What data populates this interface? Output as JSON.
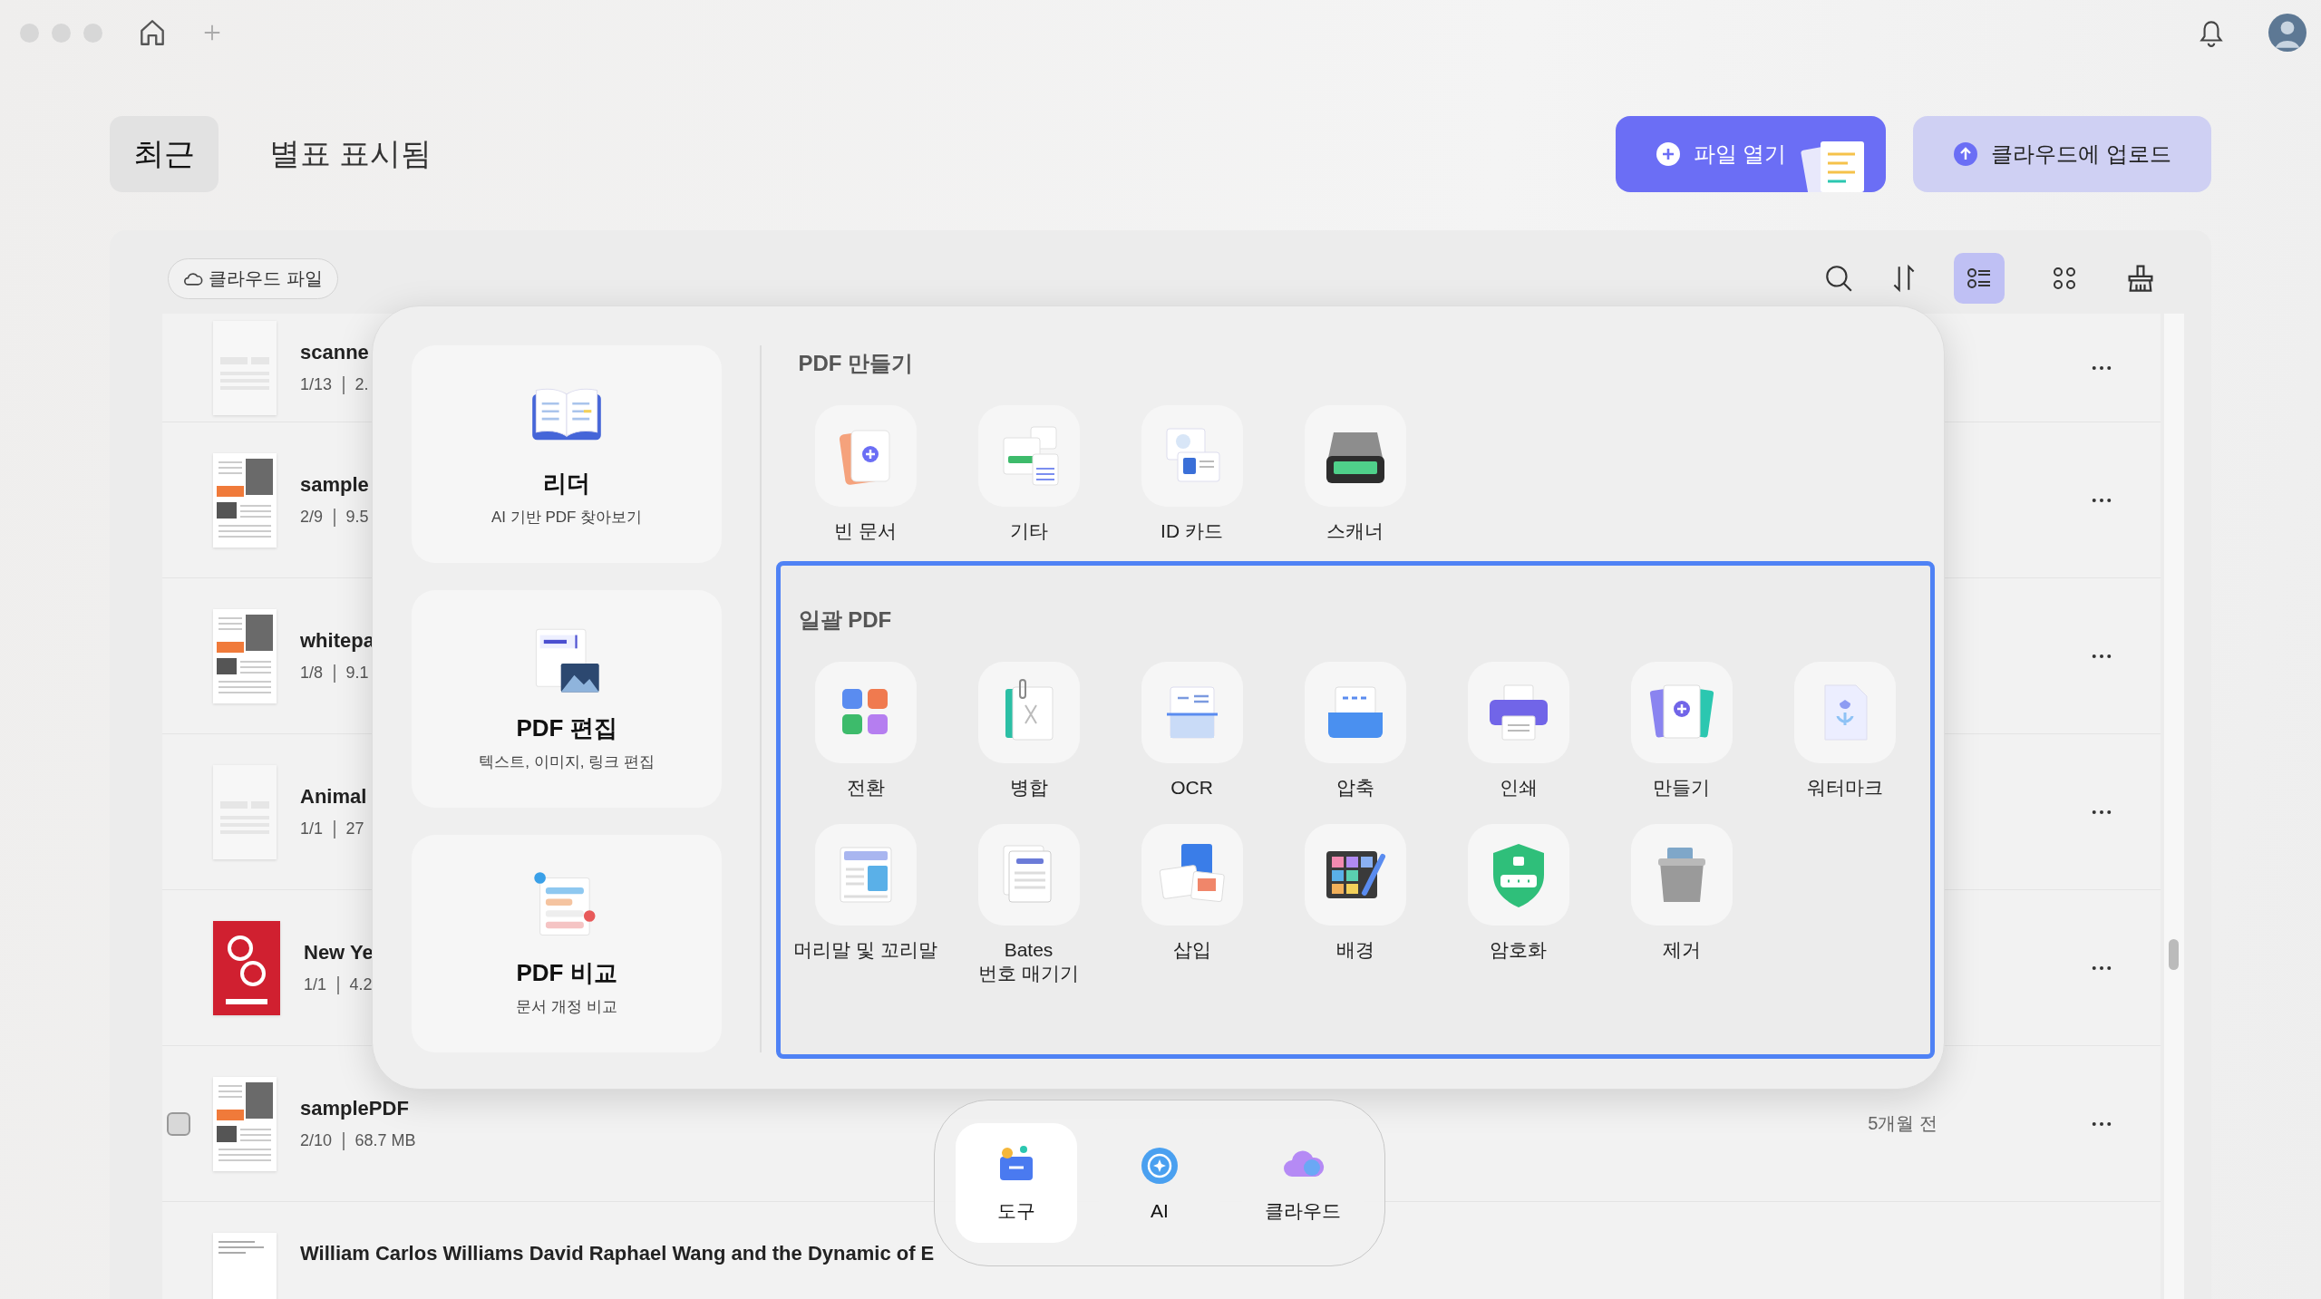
{
  "tabs": [
    {
      "label": "최근",
      "selected": true
    },
    {
      "label": "별표 표시됨",
      "selected": false
    }
  ],
  "actions": [
    {
      "label": "파일 열기",
      "kind": "open"
    },
    {
      "label": "클라우드에 업로드",
      "kind": "upload"
    }
  ],
  "toolbar": {
    "cloud_filter": "클라우드 파일",
    "views": [
      {
        "kind": "list",
        "selected": true
      },
      {
        "kind": "grid",
        "selected": false
      }
    ]
  },
  "files": [
    {
      "name": "scanne",
      "pages": "1/13",
      "size": "2.",
      "kind": "blank"
    },
    {
      "name": "sample",
      "pages": "2/9",
      "size": "9.5",
      "kind": "article"
    },
    {
      "name": "whitepa",
      "pages": "1/8",
      "size": "9.1",
      "kind": "article"
    },
    {
      "name": "Animal",
      "pages": "1/1",
      "size": "27",
      "kind": "blank"
    },
    {
      "name": "New Ye",
      "pages": "1/1",
      "size": "4.2",
      "kind": "poster"
    },
    {
      "name": "samplePDF",
      "pages": "2/10",
      "size": "68.7 MB",
      "date": "5개월 전",
      "checked": false,
      "kind": "article"
    },
    {
      "name": "William Carlos Williams David Raphael Wang and the Dynamic of E",
      "kind": "text"
    }
  ],
  "tools_menu": {
    "cards": [
      {
        "title": "리더",
        "subtitle": "AI 기반 PDF 찾아보기",
        "kind": "reader"
      },
      {
        "title": "PDF 편집",
        "subtitle": "텍스트, 이미지, 링크 편집",
        "kind": "edit"
      },
      {
        "title": "PDF 비교",
        "subtitle": "문서 개정 비교",
        "kind": "compare"
      }
    ],
    "sections": [
      {
        "title": "PDF 만들기",
        "highlighted": false,
        "tools": [
          {
            "label": "빈 문서",
            "kind": "blank"
          },
          {
            "label": "기타",
            "kind": "other"
          },
          {
            "label": "ID 카드",
            "kind": "idcard"
          },
          {
            "label": "스캐너",
            "kind": "scanner"
          }
        ]
      },
      {
        "title": "일괄 PDF",
        "highlighted": true,
        "tools": [
          {
            "label": "전환",
            "kind": "convert"
          },
          {
            "label": "병합",
            "kind": "merge"
          },
          {
            "label": "OCR",
            "kind": "ocr"
          },
          {
            "label": "압축",
            "kind": "compress"
          },
          {
            "label": "인쇄",
            "kind": "print"
          },
          {
            "label": "만들기",
            "kind": "create"
          },
          {
            "label": "워터마크",
            "kind": "watermark"
          },
          {
            "label": "머리말 및 꼬리말",
            "kind": "headerfooter"
          },
          {
            "label": "Bates\n번호 매기기",
            "kind": "bates"
          },
          {
            "label": "삽입",
            "kind": "insert"
          },
          {
            "label": "배경",
            "kind": "background"
          },
          {
            "label": "암호화",
            "kind": "encrypt"
          },
          {
            "label": "제거",
            "kind": "remove"
          }
        ]
      }
    ]
  },
  "dock": [
    {
      "label": "도구",
      "kind": "tools",
      "selected": true
    },
    {
      "label": "AI",
      "kind": "ai",
      "selected": false
    },
    {
      "label": "클라우드",
      "kind": "cloud",
      "selected": false
    }
  ]
}
